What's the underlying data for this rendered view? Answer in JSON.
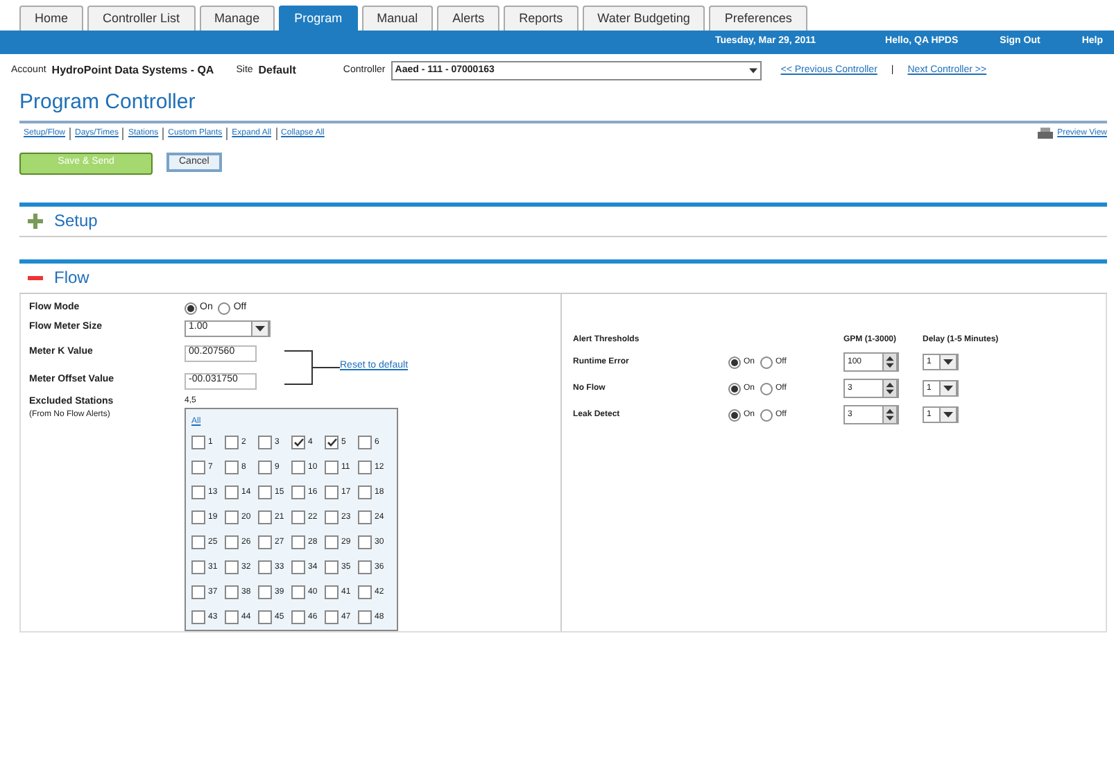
{
  "tabs": [
    {
      "label": "Home",
      "selected": false
    },
    {
      "label": "Controller List",
      "selected": false
    },
    {
      "label": "Manage",
      "selected": false
    },
    {
      "label": "Program",
      "selected": true
    },
    {
      "label": "Manual",
      "selected": false
    },
    {
      "label": "Alerts",
      "selected": false
    },
    {
      "label": "Reports",
      "selected": false
    },
    {
      "label": "Water Budgeting",
      "selected": false
    },
    {
      "label": "Preferences",
      "selected": false
    }
  ],
  "header_bar": {
    "date": "Tuesday, Mar 29, 2011",
    "user": "Hello, QA HPDS",
    "sign_out": "Sign Out",
    "help": "Help"
  },
  "context": {
    "account_label": "Account",
    "account": "HydroPoint Data Systems - QA",
    "site_label": "Site",
    "site": "Default",
    "controller_label": "Controller",
    "controller": "Aaed - 111 - 07000163",
    "previous": "<< Previous Controller",
    "separator": "|",
    "next": "Next Controller >>"
  },
  "page_title": "Program Controller",
  "section_links": [
    "Setup/Flow",
    "Days/Times",
    "Stations",
    "Custom Plants",
    "Expand All",
    "Collapse All"
  ],
  "preview_link": "Preview View",
  "buttons": [
    "Save & Send",
    "Cancel"
  ],
  "sections": [
    {
      "title": "Setup",
      "expanded": false
    },
    {
      "title": "Flow",
      "expanded": true
    }
  ],
  "flow": {
    "mode_label": "Flow Mode",
    "mode_options": [
      {
        "label": "On",
        "selected": true
      },
      {
        "label": "Off",
        "selected": false
      }
    ],
    "meter_size_label": "Flow Meter Size",
    "meter_size": "1.00",
    "k_label": "Meter K Value",
    "k_value": "00.207560",
    "offset_label": "Meter Offset Value",
    "offset_value": "-00.031750",
    "reset_link": "Reset to default",
    "excluded_label": "Excluded Stations",
    "excluded_sublabel": "(From No Flow Alerts)",
    "excluded_value": "4,5",
    "all_label": "All",
    "stations": [
      {
        "label": "1",
        "checked": false
      },
      {
        "label": "2",
        "checked": false
      },
      {
        "label": "3",
        "checked": false
      },
      {
        "label": "4",
        "checked": true
      },
      {
        "label": "5",
        "checked": true
      },
      {
        "label": "6",
        "checked": false
      },
      {
        "label": "7",
        "checked": false
      },
      {
        "label": "8",
        "checked": false
      },
      {
        "label": "9",
        "checked": false
      },
      {
        "label": "10",
        "checked": false
      },
      {
        "label": "11",
        "checked": false
      },
      {
        "label": "12",
        "checked": false
      },
      {
        "label": "13",
        "checked": false
      },
      {
        "label": "14",
        "checked": false
      },
      {
        "label": "15",
        "checked": false
      },
      {
        "label": "16",
        "checked": false
      },
      {
        "label": "17",
        "checked": false
      },
      {
        "label": "18",
        "checked": false
      },
      {
        "label": "19",
        "checked": false
      },
      {
        "label": "20",
        "checked": false
      },
      {
        "label": "21",
        "checked": false
      },
      {
        "label": "22",
        "checked": false
      },
      {
        "label": "23",
        "checked": false
      },
      {
        "label": "24",
        "checked": false
      },
      {
        "label": "25",
        "checked": false
      },
      {
        "label": "26",
        "checked": false
      },
      {
        "label": "27",
        "checked": false
      },
      {
        "label": "28",
        "checked": false
      },
      {
        "label": "29",
        "checked": false
      },
      {
        "label": "30",
        "checked": false
      },
      {
        "label": "31",
        "checked": false
      },
      {
        "label": "32",
        "checked": false
      },
      {
        "label": "33",
        "checked": false
      },
      {
        "label": "34",
        "checked": false
      },
      {
        "label": "35",
        "checked": false
      },
      {
        "label": "36",
        "checked": false
      },
      {
        "label": "37",
        "checked": false
      },
      {
        "label": "38",
        "checked": false
      },
      {
        "label": "39",
        "checked": false
      },
      {
        "label": "40",
        "checked": false
      },
      {
        "label": "41",
        "checked": false
      },
      {
        "label": "42",
        "checked": false
      },
      {
        "label": "43",
        "checked": false
      },
      {
        "label": "44",
        "checked": false
      },
      {
        "label": "45",
        "checked": false
      },
      {
        "label": "46",
        "checked": false
      },
      {
        "label": "47",
        "checked": false
      },
      {
        "label": "48",
        "checked": false
      }
    ]
  },
  "alerts": {
    "title": "Alert Thresholds",
    "gpm_header": "GPM (1-3000)",
    "delay_header": "Delay (1-5 Minutes)",
    "rows": [
      {
        "label": "Runtime Error",
        "options": [
          {
            "label": "On",
            "selected": true
          },
          {
            "label": "Off",
            "selected": false
          }
        ],
        "gpm": "100",
        "delay": "1"
      },
      {
        "label": "No Flow",
        "options": [
          {
            "label": "On",
            "selected": true
          },
          {
            "label": "Off",
            "selected": false
          }
        ],
        "gpm": "3",
        "delay": "1"
      },
      {
        "label": "Leak Detect",
        "options": [
          {
            "label": "On",
            "selected": true
          },
          {
            "label": "Off",
            "selected": false
          }
        ],
        "gpm": "3",
        "delay": "1"
      }
    ]
  }
}
